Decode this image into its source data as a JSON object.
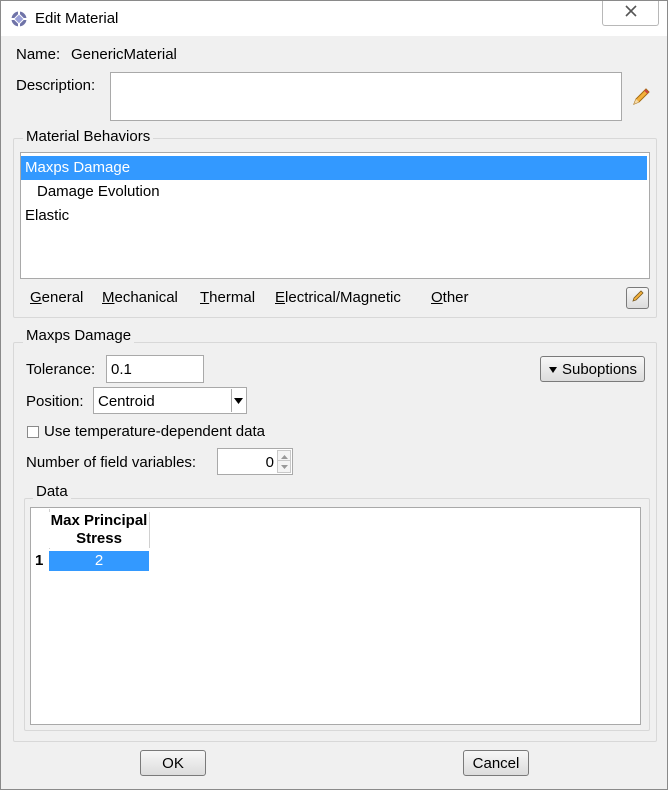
{
  "window": {
    "title": "Edit Material"
  },
  "material": {
    "name_label": "Name:",
    "name_value": "GenericMaterial",
    "description_label": "Description:",
    "description_value": ""
  },
  "behaviors": {
    "title": "Material Behaviors",
    "items": [
      {
        "label": "Maxps Damage",
        "selected": true,
        "indent": 0
      },
      {
        "label": "Damage Evolution",
        "selected": false,
        "indent": 1
      },
      {
        "label": "Elastic",
        "selected": false,
        "indent": 0
      }
    ]
  },
  "menus": [
    {
      "accel": "G",
      "rest": "eneral"
    },
    {
      "accel": "M",
      "rest": "echanical"
    },
    {
      "accel": "T",
      "rest": "hermal"
    },
    {
      "accel": "E",
      "rest": "lectrical/Magnetic"
    },
    {
      "accel": "O",
      "rest": "ther"
    }
  ],
  "section": {
    "title": "Maxps Damage",
    "tolerance_label": "Tolerance:",
    "tolerance_value": "0.1",
    "suboptions_label": "Suboptions",
    "position_label": "Position:",
    "position_value": "Centroid",
    "temp_dependent_label": "Use temperature-dependent data",
    "temp_dependent_checked": false,
    "field_vars_label": "Number of field variables:",
    "field_vars_value": "0"
  },
  "data_table": {
    "title": "Data",
    "columns": [
      "Max Principal Stress"
    ],
    "column_line1": "Max Principal",
    "column_line2": "Stress",
    "rows": [
      {
        "index": "1",
        "values": [
          "2"
        ]
      }
    ]
  },
  "buttons": {
    "ok": "OK",
    "cancel": "Cancel"
  }
}
